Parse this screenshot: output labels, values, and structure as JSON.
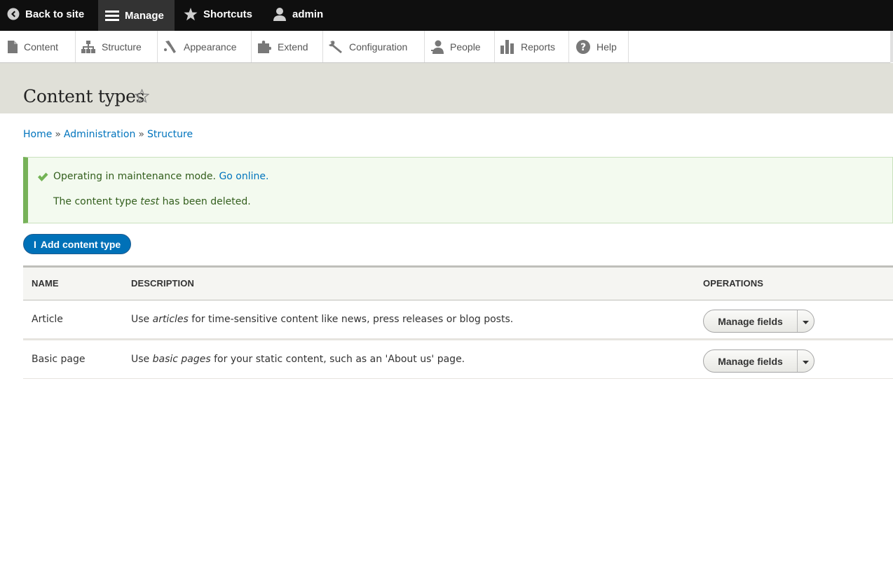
{
  "toolbar": {
    "back_label": "Back to site",
    "manage_label": "Manage",
    "shortcuts_label": "Shortcuts",
    "user_label": "admin"
  },
  "tray": {
    "items": [
      {
        "label": "Content",
        "icon": "file-icon"
      },
      {
        "label": "Structure",
        "icon": "sitemap-icon"
      },
      {
        "label": "Appearance",
        "icon": "paintbrush-icon"
      },
      {
        "label": "Extend",
        "icon": "puzzle-icon"
      },
      {
        "label": "Configuration",
        "icon": "wrench-icon"
      },
      {
        "label": "People",
        "icon": "person-icon"
      },
      {
        "label": "Reports",
        "icon": "bar-chart-icon"
      },
      {
        "label": "Help",
        "icon": "question-icon"
      }
    ]
  },
  "page": {
    "title": "Content types"
  },
  "breadcrumb": {
    "items": [
      "Home",
      "Administration",
      "Structure"
    ],
    "separator": "»"
  },
  "messages": {
    "line1_text": "Operating in maintenance mode.",
    "line1_link": "Go online.",
    "line2_prefix": "The content type",
    "line2_em": "test",
    "line2_suffix": "has been deleted."
  },
  "actions": {
    "add_label": "Add content type",
    "add_prefix": "I"
  },
  "table": {
    "headers": [
      "NAME",
      "DESCRIPTION",
      "OPERATIONS"
    ],
    "rows": [
      {
        "name": "Article",
        "desc_prefix": "Use",
        "desc_em": "articles",
        "desc_suffix": "for time-sensitive content like news, press releases or blog posts.",
        "operation": "Manage fields"
      },
      {
        "name": "Basic page",
        "desc_prefix": "Use",
        "desc_em": "basic pages",
        "desc_suffix": "for your static content, such as an 'About us' page.",
        "operation": "Manage fields"
      }
    ]
  },
  "colors": {
    "toolbar_bg": "#0f0f0f",
    "link": "#0074bd",
    "primary_button": "#0071b8",
    "success_border": "#77b259",
    "header_bg": "#e0e0d8"
  }
}
